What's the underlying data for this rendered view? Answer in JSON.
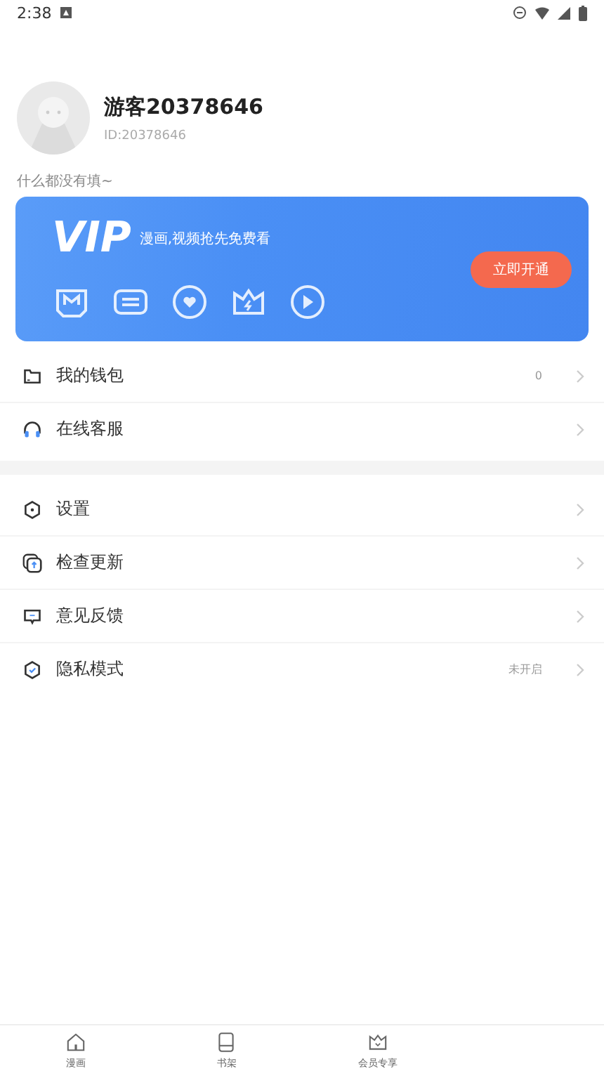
{
  "status_bar": {
    "time": "2:38"
  },
  "profile": {
    "name": "游客20378646",
    "id": "ID:20378646",
    "bio": "什么都没有填~"
  },
  "vip_banner": {
    "logo": "VIP",
    "slogan": "漫画,视频抢先免费看",
    "button": "立即开通",
    "perks": [
      {
        "kind": "manga"
      },
      {
        "kind": "ad"
      },
      {
        "kind": "heart"
      },
      {
        "kind": "crown"
      },
      {
        "kind": "play"
      }
    ]
  },
  "menu_groups": [
    [
      {
        "kind": "wallet",
        "label": "我的钱包",
        "value": "0"
      },
      {
        "kind": "service",
        "label": "在线客服"
      }
    ],
    [
      {
        "kind": "settings",
        "label": "设置"
      },
      {
        "kind": "update",
        "label": "检查更新"
      },
      {
        "kind": "feedback",
        "label": "意见反馈"
      },
      {
        "kind": "privacy",
        "label": "隐私模式",
        "value": "未开启"
      }
    ]
  ],
  "bottom_nav": [
    {
      "kind": "home",
      "label": "漫画"
    },
    {
      "kind": "shelf",
      "label": "书架"
    },
    {
      "kind": "vip",
      "label": "会员专享"
    }
  ]
}
